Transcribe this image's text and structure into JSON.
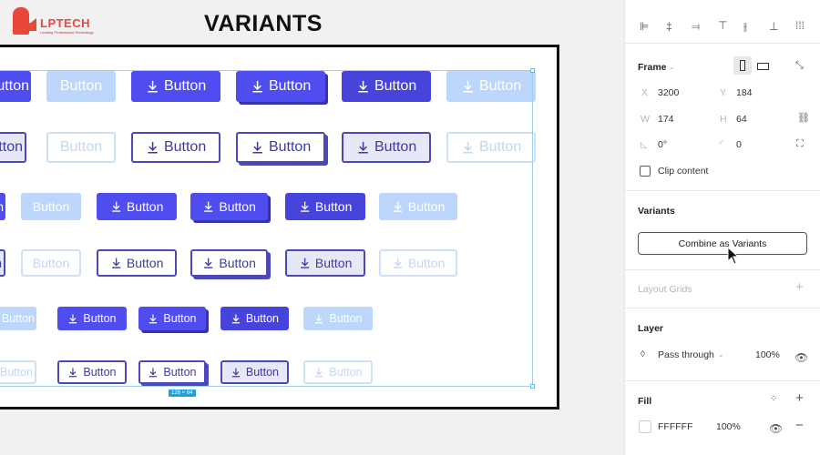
{
  "header": {
    "logo_text": "LPTECH",
    "logo_tagline": "Leading Professional Technology",
    "title": "VARIANTS"
  },
  "canvas": {
    "size_badge": "128 × 64",
    "colors": {
      "primary": "#4f4cf0",
      "light": "#bdd6fb",
      "outline": "#4b49b8"
    },
    "rows": [
      {
        "items": [
          {
            "label": "Button",
            "style": "primary",
            "icon": false
          },
          {
            "label": "Button",
            "style": "light",
            "icon": false
          },
          {
            "label": "Button",
            "style": "primary",
            "icon": true
          },
          {
            "label": "Button",
            "style": "shadow",
            "icon": true
          },
          {
            "label": "Button",
            "style": "dark",
            "icon": true
          },
          {
            "label": "Button",
            "style": "light",
            "icon": true
          }
        ]
      },
      {
        "items": [
          {
            "label": "Button",
            "style": "opress",
            "icon": false
          },
          {
            "label": "Button",
            "style": "odis",
            "icon": false
          },
          {
            "label": "Button",
            "style": "outline",
            "icon": true
          },
          {
            "label": "Button",
            "style": "oshadow",
            "icon": true
          },
          {
            "label": "Button",
            "style": "opress",
            "icon": true
          },
          {
            "label": "Button",
            "style": "odis",
            "icon": true
          }
        ]
      },
      {
        "items": [
          {
            "label": "Button",
            "style": "primary",
            "icon": false
          },
          {
            "label": "Button",
            "style": "light",
            "icon": false
          },
          {
            "label": "Button",
            "style": "primary",
            "icon": true
          },
          {
            "label": "Button",
            "style": "shadow",
            "icon": true
          },
          {
            "label": "Button",
            "style": "dark",
            "icon": true
          },
          {
            "label": "Button",
            "style": "light",
            "icon": true
          }
        ]
      },
      {
        "items": [
          {
            "label": "Button",
            "style": "opress",
            "icon": false
          },
          {
            "label": "Button",
            "style": "odis",
            "icon": false
          },
          {
            "label": "Button",
            "style": "outline",
            "icon": true
          },
          {
            "label": "Button",
            "style": "oshadow",
            "icon": true
          },
          {
            "label": "Button",
            "style": "opress",
            "icon": true
          },
          {
            "label": "Button",
            "style": "odis",
            "icon": true
          }
        ]
      },
      {
        "items": [
          {
            "label": "Button",
            "style": "light",
            "icon": false
          },
          {
            "label": "Button",
            "style": "primary",
            "icon": true
          },
          {
            "label": "Button",
            "style": "shadow",
            "icon": true
          },
          {
            "label": "Button",
            "style": "dark",
            "icon": true
          },
          {
            "label": "Button",
            "style": "light",
            "icon": true
          }
        ]
      },
      {
        "items": [
          {
            "label": "Button",
            "style": "odis",
            "icon": false
          },
          {
            "label": "Button",
            "style": "outline",
            "icon": true
          },
          {
            "label": "Button",
            "style": "oshadow",
            "icon": true
          },
          {
            "label": "Button",
            "style": "opress",
            "icon": true
          },
          {
            "label": "Button",
            "style": "odis",
            "icon": true
          }
        ]
      }
    ]
  },
  "panel": {
    "frame": {
      "title": "Frame",
      "x_label": "X",
      "x": "3200",
      "y_label": "Y",
      "y": "184",
      "w_label": "W",
      "w": "174",
      "h_label": "H",
      "h": "64",
      "rotation": "0°",
      "radius": "0",
      "clip_content": "Clip content",
      "clip_checked": false
    },
    "variants": {
      "title": "Variants",
      "combine_button": "Combine as Variants"
    },
    "layout_grids": {
      "title": "Layout Grids"
    },
    "layer": {
      "title": "Layer",
      "blend": "Pass through",
      "opacity": "100%"
    },
    "fill": {
      "title": "Fill",
      "hex": "FFFFFF",
      "opacity": "100%",
      "swatch": "#FFFFFF"
    }
  }
}
